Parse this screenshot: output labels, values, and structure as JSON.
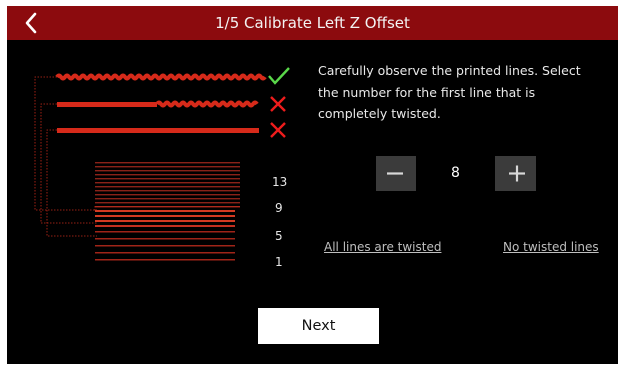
{
  "header": {
    "back_icon": "chevron-left-icon",
    "title": "1/5 Calibrate Left Z Offset"
  },
  "instructions": "Carefully observe the printed lines. Select the number for the first line that is completely twisted.",
  "stepper": {
    "minus_icon": "minus-icon",
    "plus_icon": "plus-icon",
    "value": "8"
  },
  "links": {
    "all_twisted": "All lines are twisted",
    "no_twisted": "No twisted lines"
  },
  "next_button": "Next",
  "diagram": {
    "status_icons": [
      "check-icon",
      "x-icon",
      "x-icon"
    ],
    "line_numbers": [
      "13",
      "9",
      "5",
      "1"
    ]
  },
  "colors": {
    "header_bg": "#8c0b0e",
    "line_red": "#d62a1a",
    "check_green": "#5ad84a",
    "x_red": "#ee1c1c"
  }
}
